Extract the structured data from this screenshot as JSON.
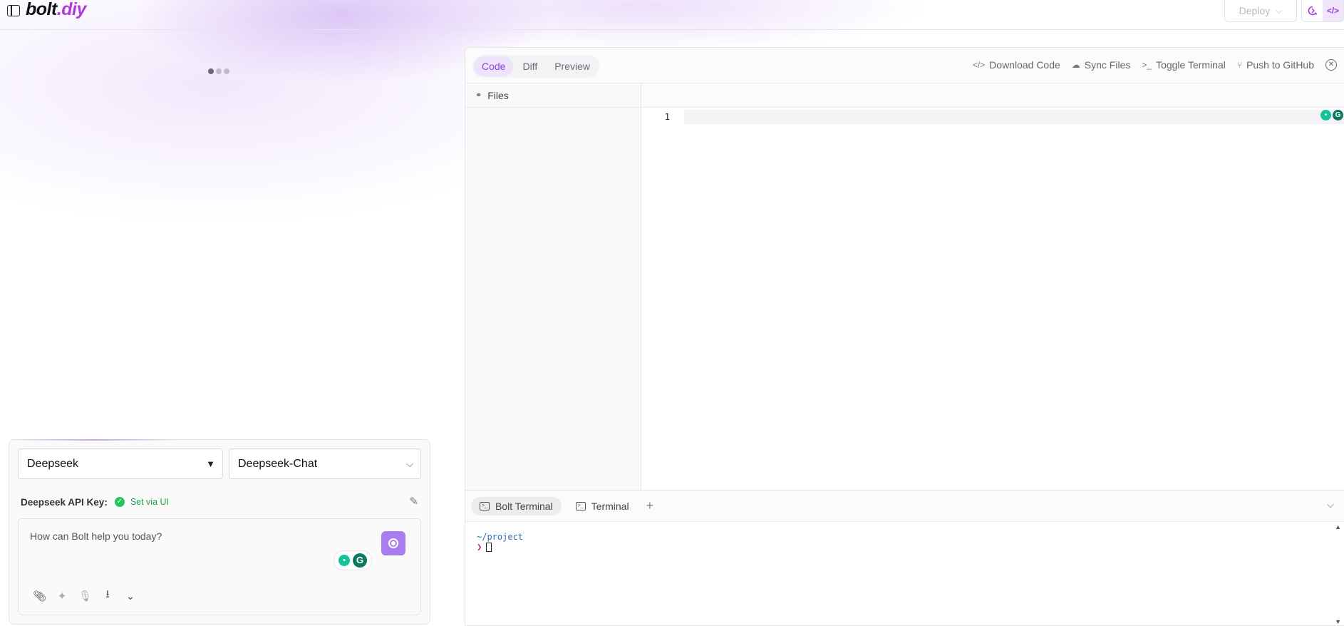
{
  "header": {
    "logo_main": "bolt",
    "logo_accent": ".diy",
    "deploy_label": "Deploy",
    "deploy_chevron": "⌵",
    "chat_view_icon": "bolt-chat-icon",
    "code_view_icon": "</>"
  },
  "chat": {
    "provider_selected": "Deepseek",
    "model_selected": "Deepseek-Chat",
    "api_key_label": "Deepseek API Key:",
    "api_key_status": "Set via UI",
    "prompt_placeholder": "How can Bolt help you today?"
  },
  "workbench": {
    "tabs": [
      {
        "label": "Code",
        "active": true
      },
      {
        "label": "Diff",
        "active": false
      },
      {
        "label": "Preview",
        "active": false
      }
    ],
    "actions": {
      "download": "Download Code",
      "sync": "Sync Files",
      "toggle_terminal": "Toggle Terminal",
      "push": "Push to GitHub"
    },
    "files_label": "Files",
    "editor_line_number": "1"
  },
  "terminal": {
    "tabs": [
      {
        "label": "Bolt Terminal",
        "active": true
      },
      {
        "label": "Terminal",
        "active": false
      }
    ],
    "add_label": "+",
    "path": "~/project",
    "prompt": "❯"
  },
  "colors": {
    "accent": "#8e3fe0",
    "send_button": "#a97cf0",
    "success": "#22c55e"
  }
}
